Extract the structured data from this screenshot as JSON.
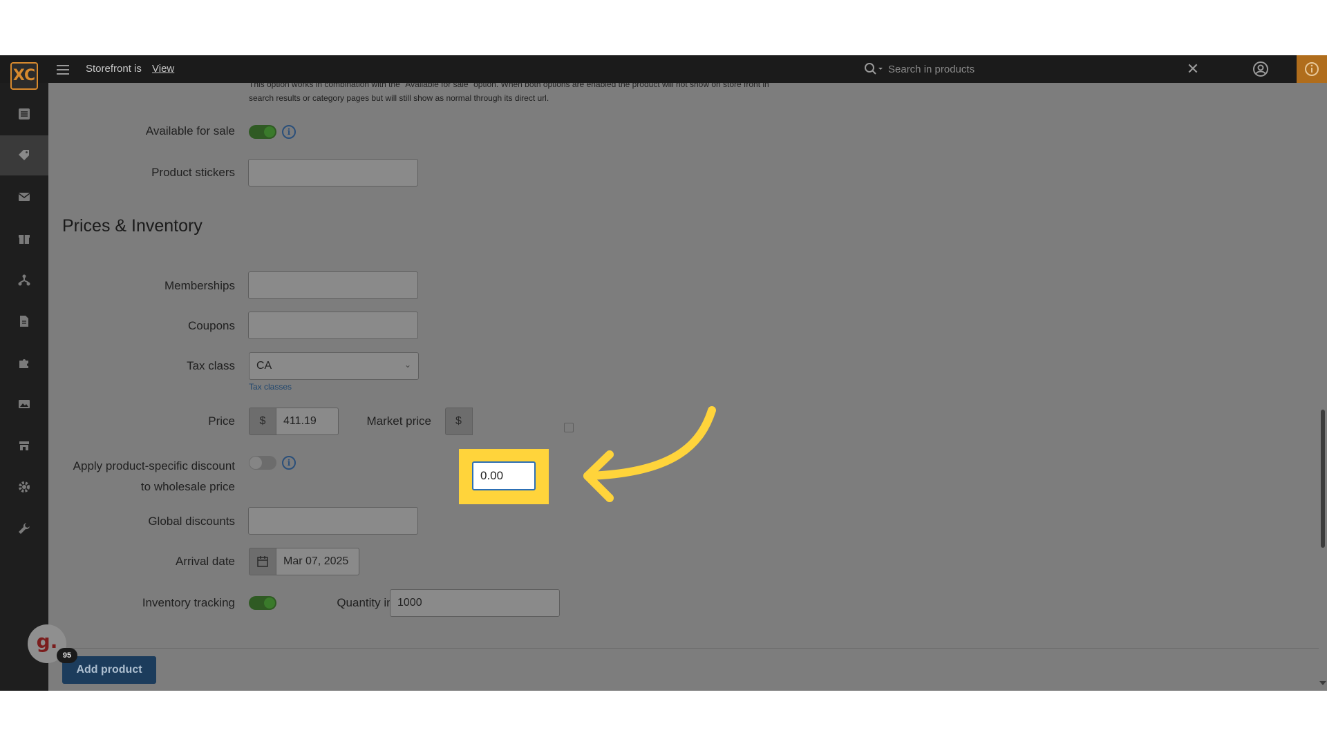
{
  "topbar": {
    "logo": "XC",
    "storefront_label": "Storefront is",
    "storefront_link": "View",
    "search_placeholder": "Search in products"
  },
  "sidebar": {
    "items": [
      {
        "icon": "list-icon"
      },
      {
        "icon": "tag-icon",
        "active": true
      },
      {
        "icon": "envelope-icon"
      },
      {
        "icon": "gift-icon"
      },
      {
        "icon": "network-icon"
      },
      {
        "icon": "document-icon"
      },
      {
        "icon": "puzzle-icon"
      },
      {
        "icon": "image-icon"
      },
      {
        "icon": "store-icon"
      },
      {
        "icon": "gear-icon"
      },
      {
        "icon": "wrench-icon"
      }
    ]
  },
  "form": {
    "note_line1": "This option works in combination with the \"Available for sale\" option. When both options are enabled the product will not show on store front in",
    "note_line2": "search results or category pages but will still show as normal through its direct url.",
    "available_for_sale_label": "Available for sale",
    "available_for_sale": true,
    "product_stickers_label": "Product stickers",
    "section_title": "Prices & Inventory",
    "memberships_label": "Memberships",
    "coupons_label": "Coupons",
    "tax_class_label": "Tax class",
    "tax_class_value": "CA",
    "tax_classes_link": "Tax classes",
    "price_label": "Price",
    "currency_symbol": "$",
    "price_value": "411.19",
    "market_price_label": "Market price",
    "market_currency_partial": "$",
    "market_price_value": "0.00",
    "discount_label_line1": "Apply product-specific discount",
    "discount_label_line2": "to wholesale price",
    "discount_enabled": false,
    "global_discounts_label": "Global discounts",
    "arrival_date_label": "Arrival date",
    "arrival_date_value": "Mar 07, 2025",
    "inventory_tracking_label": "Inventory tracking",
    "inventory_tracking": true,
    "quantity_label": "Quantity in stock",
    "quantity_value": "1000"
  },
  "footer": {
    "add_product_label": "Add product",
    "badge_letter": "g.",
    "badge_count": "95"
  },
  "colors": {
    "highlight": "#ffd43b",
    "topbar": "#1b1b1b",
    "accent_orange": "#d88a2e"
  }
}
